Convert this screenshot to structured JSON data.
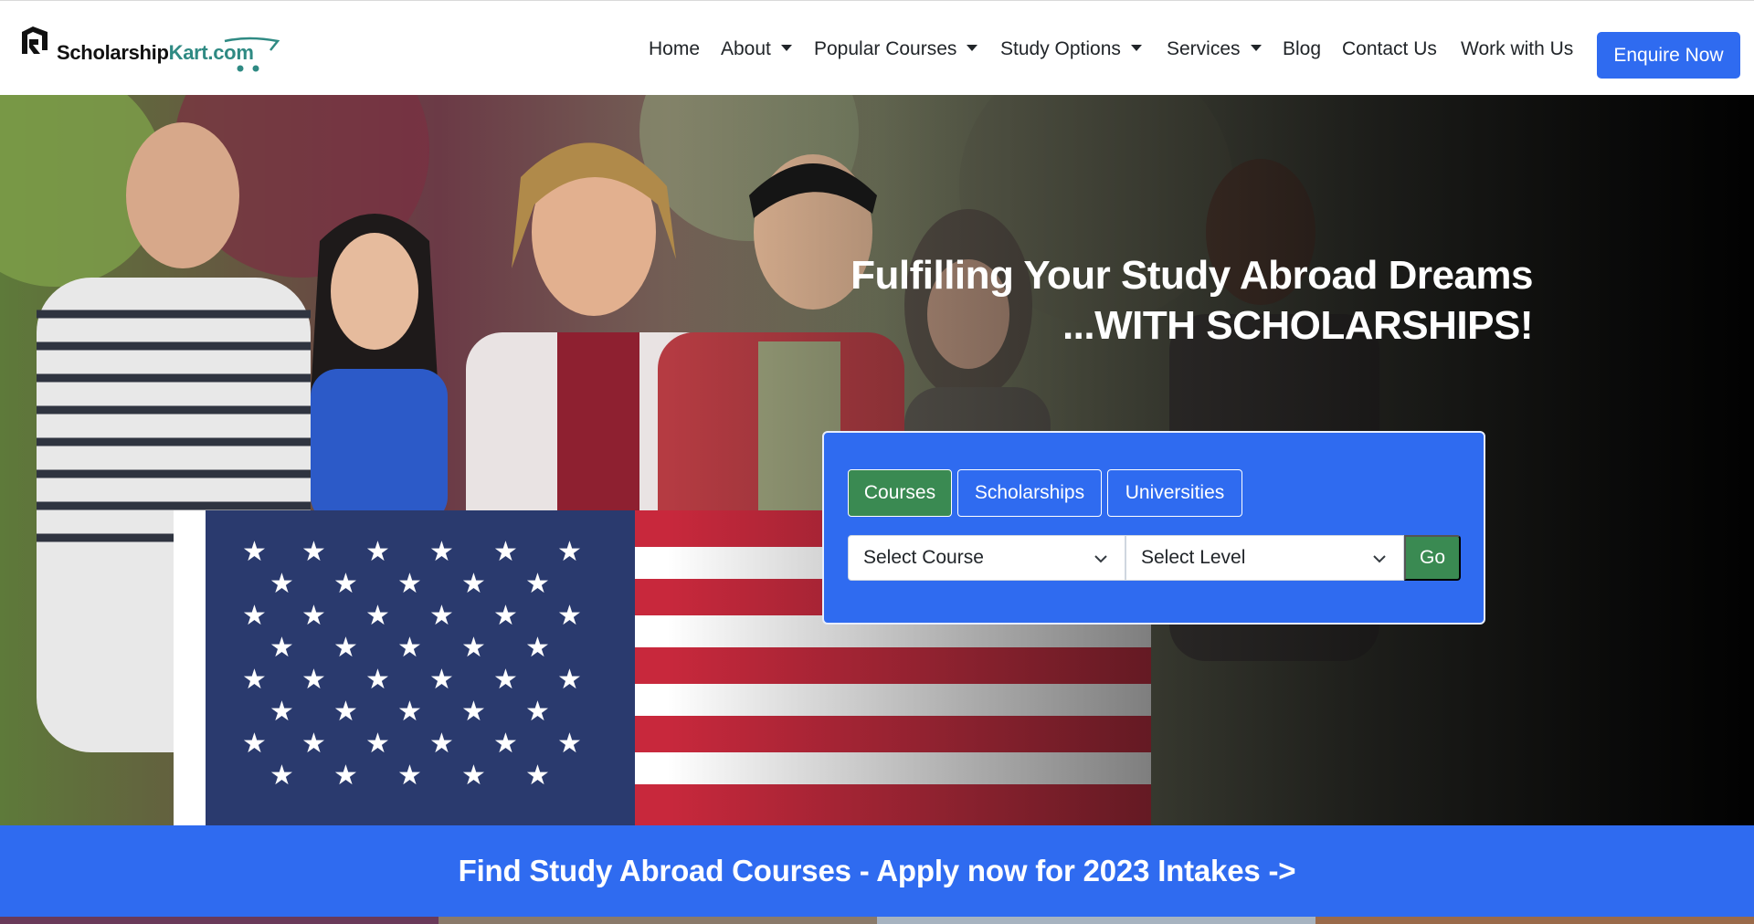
{
  "brand": {
    "logo_main": "Scholarship",
    "logo_accent": "Kart.com"
  },
  "nav": {
    "items": [
      {
        "label": "Home",
        "dropdown": false
      },
      {
        "label": "About",
        "dropdown": true
      },
      {
        "label": "Popular Courses",
        "dropdown": true
      },
      {
        "label": "Study Options",
        "dropdown": true
      },
      {
        "label": "Services",
        "dropdown": true
      },
      {
        "label": "Blog",
        "dropdown": false
      },
      {
        "label": "Contact Us",
        "dropdown": false
      },
      {
        "label": "Work with Us",
        "dropdown": false
      }
    ],
    "cta_label": "Enquire Now"
  },
  "hero": {
    "title_line1": "Fulfilling Your Study Abroad Dreams",
    "title_line2": "...WITH SCHOLARSHIPS!"
  },
  "search": {
    "tabs": [
      {
        "label": "Courses",
        "active": true
      },
      {
        "label": "Scholarships",
        "active": false
      },
      {
        "label": "Universities",
        "active": false
      }
    ],
    "course_select": "Select Course",
    "level_select": "Select Level",
    "go_label": "Go"
  },
  "banner": {
    "text": "Find Study Abroad Courses - Apply now for 2023 Intakes ->"
  },
  "colors": {
    "primary": "#2f6bf0",
    "success": "#3a8a52",
    "brand_teal": "#2f8a83",
    "text": "#212529"
  }
}
